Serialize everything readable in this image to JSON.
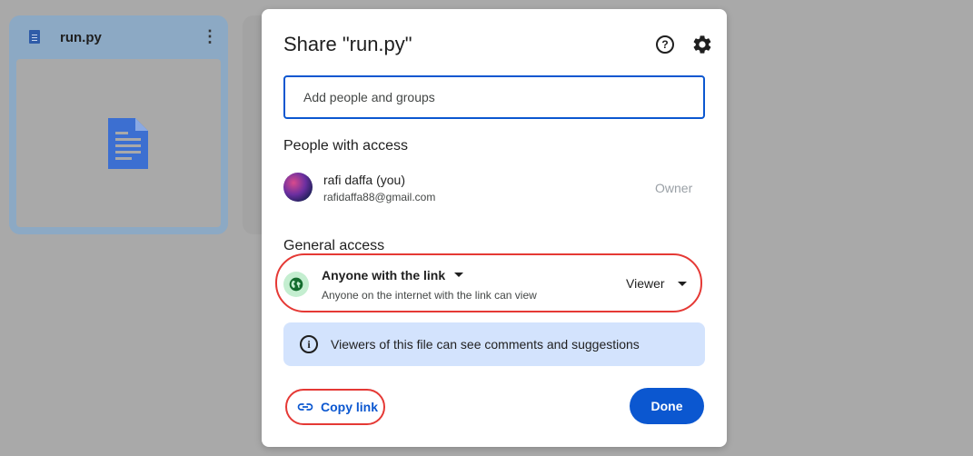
{
  "background": {
    "file_card": {
      "name": "run.py",
      "menu_glyph": "⋮"
    },
    "icons": {
      "file_icon": "doc-icon",
      "preview": "document-preview-icon"
    }
  },
  "dialog": {
    "title": "Share \"run.py\"",
    "help_icon": "help-icon",
    "settings_icon": "gear-icon",
    "add_people": {
      "placeholder": "Add people and groups",
      "value": ""
    },
    "people_section_title": "People with access",
    "people": [
      {
        "name": "rafi daffa (you)",
        "email": "rafidaffa88@gmail.com",
        "role": "Owner"
      }
    ],
    "general_access": {
      "title": "General access",
      "access_label": "Anyone with the link",
      "access_description": "Anyone on the internet with the link can view",
      "role": "Viewer",
      "icon": "globe-icon"
    },
    "info": {
      "icon": "info-icon",
      "text": "Viewers of this file can see comments and suggestions"
    },
    "copy_link_label": "Copy link",
    "done_label": "Done"
  },
  "colors": {
    "accent": "#0b57d0",
    "highlight_outline": "#e53935",
    "info_bg": "#d3e3fd",
    "globe_bg": "#c4eed0",
    "overlay": "#a9a9a9"
  }
}
